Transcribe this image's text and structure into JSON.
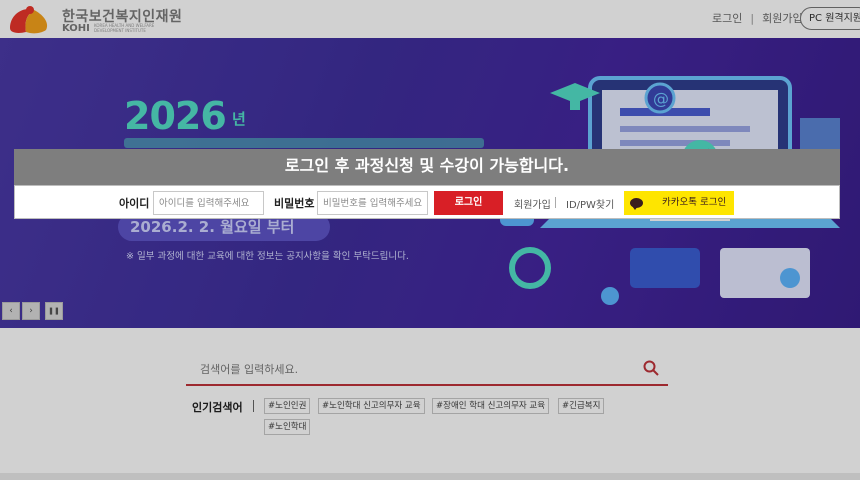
{
  "header": {
    "logo_kr": "한국보건복지인재원",
    "logo_en": "KOHI",
    "logo_sub": "KOREA HEALTH AND WELFARE DEVELOPMENT INSTITUTE",
    "links": [
      "로그인",
      "회원가입"
    ],
    "pc_button": "PC 원격지원"
  },
  "banner": {
    "year": "2026",
    "year_suffix": "년",
    "date": "2026.2. 2. 월요일 부터",
    "note": "※ 일부 과정에 대한 교육에 대한 정보는 공지사항을 확인 부탁드립니다.",
    "controls": {
      "prev": "‹",
      "next": "›",
      "pause": "❚❚"
    }
  },
  "login": {
    "message": "로그인 후 과정신청 및 수강이 가능합니다.",
    "id_label": "아이디",
    "id_placeholder": "아이디를 입력해주세요",
    "pw_label": "비밀번호",
    "pw_placeholder": "비밀번호를 입력해주세요",
    "login_button": "로그인",
    "signup": "회원가입",
    "find": "ID/PW찾기",
    "kakao": "카카오톡 로그인"
  },
  "search": {
    "placeholder": "검색어를 입력하세요.",
    "popular_label": "인기검색어",
    "tags": [
      "#노인인권",
      "#노인학대 신고의무자 교육",
      "#장애인 학대 신고의무자 교육",
      "#긴급복지",
      "#노인학대"
    ]
  },
  "colors": {
    "banner": "#4b3aa8",
    "accent_teal": "#55e0c8",
    "login_red": "#d81f26",
    "kakao_yellow": "#fee500",
    "search_line": "#c0323a"
  }
}
